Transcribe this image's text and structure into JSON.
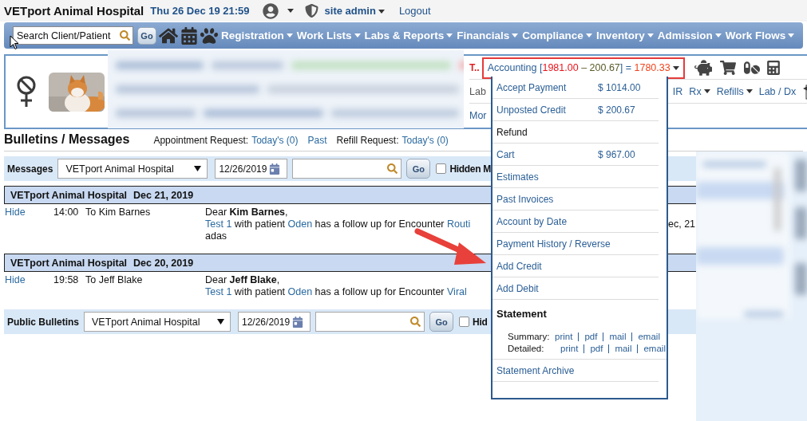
{
  "header": {
    "title": "VETport Animal Hospital",
    "datetime": "Thu 26 Dec 19 21:59",
    "user": "site admin",
    "logout": "Logout"
  },
  "nav": {
    "search_placeholder": "Search Client/Patient",
    "go": "Go",
    "menus": [
      "Registration",
      "Work Lists",
      "Labs & Reports",
      "Financials",
      "Compliance",
      "Inventory",
      "Admission",
      "Work Flows"
    ]
  },
  "patient": {
    "name_fragment": "T..",
    "accounting": [
      {
        "text": "Accounting [",
        "color": "#2b5f96"
      },
      {
        "text": "1981.00",
        "color": "#e8141c"
      },
      {
        "text": " – 200.67",
        "color": "#5a5a2a"
      },
      {
        "text": "] = ",
        "color": "#2b5f96"
      },
      {
        "text": "1780.33",
        "color": "#f0441c"
      }
    ],
    "row_2_left": "Lab",
    "row_2_links": [
      {
        "label": "IR",
        "dropdown": false
      },
      {
        "label": "Rx",
        "dropdown": true
      },
      {
        "label": "Refills",
        "dropdown": true
      },
      {
        "label": "Lab / Dx",
        "dropdown": false
      }
    ],
    "row_3_left": "Mor"
  },
  "bulletins": {
    "title": "Bulletins / Messages",
    "requests": [
      {
        "text": "Appointment Request:",
        "kind": "label"
      },
      {
        "text": "Today's (0)",
        "kind": "link"
      },
      {
        "text": "Past",
        "kind": "link"
      },
      {
        "text": "Refill Request:",
        "kind": "label"
      },
      {
        "text": "Today's (0)",
        "kind": "link"
      }
    ]
  },
  "messages_filter": {
    "label": "Messages",
    "location": "VETport Animal Hospital",
    "date": "12/26/2019",
    "go": "Go",
    "hidden_label": "Hidden M",
    "hidden_checked": false
  },
  "groups": [
    {
      "location": "VETport Animal Hospital",
      "date": "Dec 21, 2019",
      "messages": [
        {
          "action": "Hide",
          "time": "14:00",
          "to": "To Kim Barnes",
          "greeting": "Dear **Kim Barnes**,",
          "body": [
            {
              "text": "Test 1",
              "kind": "link"
            },
            {
              "text": " with patient ",
              "kind": "plain"
            },
            {
              "text": "Oden",
              "kind": "link"
            },
            {
              "text": " has a follow up for Encounter ",
              "kind": "plain"
            },
            {
              "text": "Routi",
              "kind": "link"
            }
          ],
          "note": "adas",
          "tail": "ec, 21"
        }
      ]
    },
    {
      "location": "VETport Animal Hospital",
      "date": "Dec 20, 2019",
      "messages": [
        {
          "action": "Hide",
          "time": "19:58",
          "to": "To Jeff Blake",
          "greeting": "Dear **Jeff Blake**,",
          "body": [
            {
              "text": "Test 1",
              "kind": "link"
            },
            {
              "text": " with patient ",
              "kind": "plain"
            },
            {
              "text": "Oden",
              "kind": "link"
            },
            {
              "text": " has a follow up for Encounter ",
              "kind": "plain"
            },
            {
              "text": "Viral",
              "kind": "link"
            }
          ]
        }
      ]
    }
  ],
  "public_filter": {
    "label": "Public Bulletins",
    "location": "VETport Animal Hospital",
    "date": "12/26/2019",
    "go": "Go",
    "hidden_label": "Hid",
    "hidden_checked": false
  },
  "accounting_menu": {
    "items": [
      {
        "kind": "link",
        "label": "Accept Payment",
        "amount": "$ 1014.00"
      },
      {
        "kind": "link",
        "label": "Unposted Credit",
        "amount": "$ 200.67"
      },
      {
        "kind": "plain",
        "label": "Refund"
      },
      {
        "kind": "link",
        "label": "Cart",
        "amount": "$ 967.00"
      },
      {
        "kind": "link",
        "label": "Estimates"
      },
      {
        "kind": "link",
        "label": "Past Invoices"
      },
      {
        "kind": "link",
        "label": "Account by Date"
      },
      {
        "kind": "link",
        "label": "Payment History / Reverse"
      },
      {
        "kind": "link",
        "label": "Add Credit"
      },
      {
        "kind": "link",
        "label": "Add Debit"
      },
      {
        "kind": "heading",
        "label": "Statement"
      },
      {
        "kind": "statement_links",
        "rows": [
          {
            "label": "Summary:",
            "links": [
              "print",
              "pdf",
              "mail",
              "email"
            ]
          },
          {
            "label": "Detailed:",
            "links": [
              "print",
              "pdf",
              "mail",
              "email"
            ]
          }
        ]
      },
      {
        "kind": "link",
        "label": "Statement Archive"
      }
    ]
  }
}
